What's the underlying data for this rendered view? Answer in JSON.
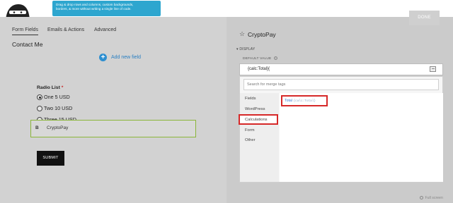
{
  "topbar": {
    "tooltip_line1": "Drag & drop rows and columns, custom backgrounds,",
    "tooltip_line2": "borders, & more without writing a single line of code.",
    "done_label": "DONE"
  },
  "builder": {
    "tabs": [
      {
        "label": "Form Fields"
      },
      {
        "label": "Emails & Actions"
      },
      {
        "label": "Advanced"
      }
    ],
    "form_title": "Contact Me",
    "add_field_label": "Add new field",
    "radio": {
      "label": "Radio List",
      "required_mark": "*",
      "options": [
        {
          "label": "One 5 USD",
          "selected": true
        },
        {
          "label": "Two 10 USD",
          "selected": false
        },
        {
          "label": "Three 15 USD",
          "selected": false
        }
      ]
    },
    "crypto_field": {
      "icon": "B",
      "label": "CryptoPay"
    },
    "submit_label": "SUBMIT"
  },
  "panel": {
    "title": "CryptoPay",
    "section": "DISPLAY",
    "default_value_label": "DEFAULT VALUE",
    "default_value": "{calc:Total}{",
    "merge": {
      "search_placeholder": "Search for merge tags",
      "categories": [
        {
          "label": "Fields",
          "active": false
        },
        {
          "label": "WordPress",
          "active": false
        },
        {
          "label": "Calculations",
          "active": true
        },
        {
          "label": "Form",
          "active": false
        },
        {
          "label": "Other",
          "active": false
        }
      ],
      "tag_label": "Total",
      "tag_code": "{calc:Total}"
    },
    "fullscreen_label": "Full screen"
  },
  "colors": {
    "tooltip_bg": "#2ea6cf",
    "accent_blue": "#2e8fd0",
    "highlight_red": "#d62828",
    "field_border_green": "#8ab53a"
  }
}
